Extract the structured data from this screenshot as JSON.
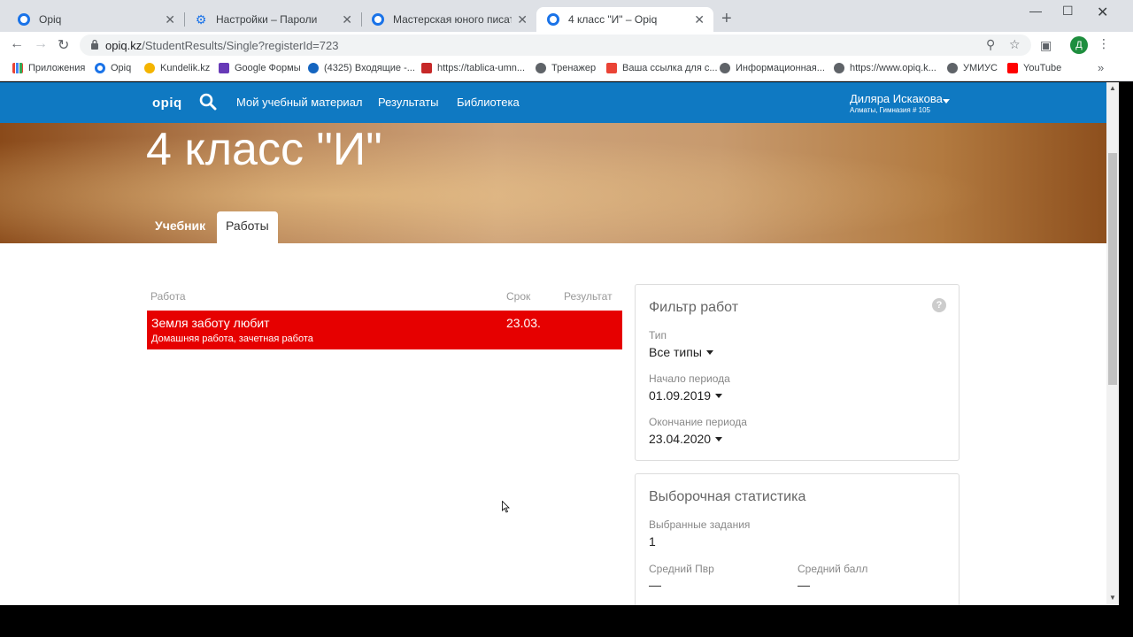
{
  "browser": {
    "tabs": [
      {
        "label": "Opiq",
        "icon": "opiq-icon"
      },
      {
        "label": "Настройки – Пароли",
        "icon": "gear-icon"
      },
      {
        "label": "Мастерская юного писателя – О",
        "icon": "opiq-icon"
      },
      {
        "label": "4 класс \"И\" – Opiq",
        "icon": "opiq-icon"
      }
    ],
    "url_host": "opiq.kz",
    "url_path": "/StudentResults/Single?registerId=723",
    "profile_initial": "Д",
    "bookmarks": [
      {
        "label": "Приложения",
        "color": "#4285f4"
      },
      {
        "label": "Opiq",
        "color": "#1a73e8"
      },
      {
        "label": "Kundelik.kz",
        "color": "#f4b400"
      },
      {
        "label": "Google Формы",
        "color": "#673ab7"
      },
      {
        "label": "(4325) Входящие -...",
        "color": "#1565c0"
      },
      {
        "label": "https://tablica-umn...",
        "color": "#c62828"
      },
      {
        "label": "Тренажер",
        "color": "#5f6368"
      },
      {
        "label": "Ваша ссылка для с...",
        "color": "#ea4335"
      },
      {
        "label": "Информационная...",
        "color": "#5f6368"
      },
      {
        "label": "https://www.opiq.k...",
        "color": "#5f6368"
      },
      {
        "label": "УМИУС",
        "color": "#5f6368"
      },
      {
        "label": "YouTube",
        "color": "#ff0000"
      }
    ]
  },
  "site": {
    "logo": "opiq",
    "nav": [
      "Мой учебный материал",
      "Результаты",
      "Библиотека"
    ],
    "user_name": "Диляра Искакова",
    "user_school": "Алматы, Гимназия # 105",
    "accent": "#0f79c2"
  },
  "hero": {
    "title": "4 класс \"И\"",
    "tabs": [
      "Учебник",
      "Работы"
    ]
  },
  "works": {
    "headers": {
      "work": "Работа",
      "due": "Срок",
      "result": "Результат"
    },
    "rows": [
      {
        "title": "Земля заботу любит",
        "subtitle": "Домашняя работа, зачетная работа",
        "due": "23.03.",
        "result": "",
        "status_color": "#e60000"
      }
    ]
  },
  "filter": {
    "title": "Фильтр работ",
    "help": "?",
    "type_label": "Тип",
    "type_value": "Все типы",
    "start_label": "Начало периода",
    "start_value": "01.09.2019",
    "end_label": "Окончание периода",
    "end_value": "23.04.2020"
  },
  "stats": {
    "title": "Выборочная статистика",
    "selected_label": "Выбранные задания",
    "selected_value": "1",
    "avg_pvr_label": "Средний Пвр",
    "avg_pvr_value": "—",
    "avg_score_label": "Средний балл",
    "avg_score_value": "—"
  }
}
